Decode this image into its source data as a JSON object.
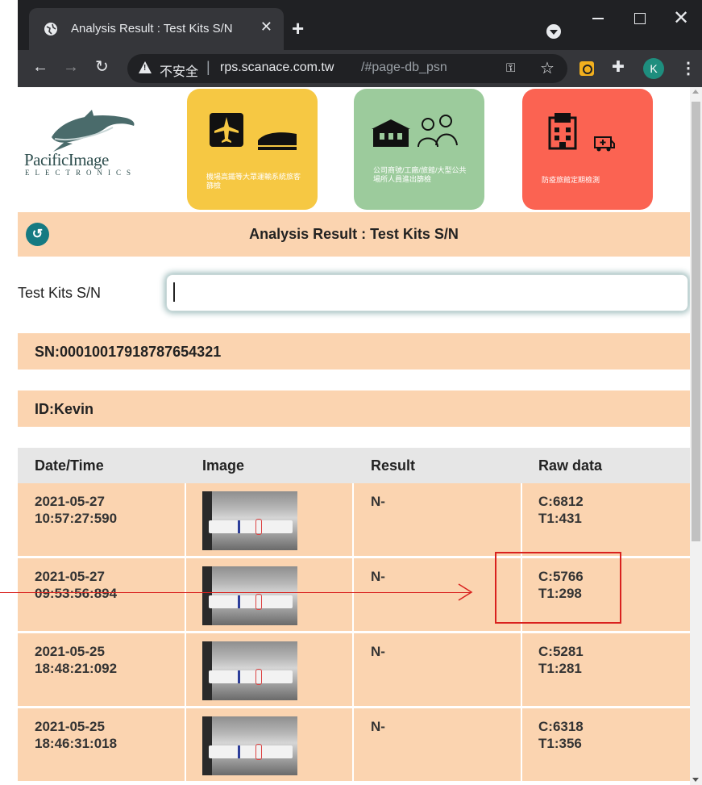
{
  "browser": {
    "tab_title": "Analysis Result : Test Kits S/N",
    "tab_close": "✕",
    "new_tab": "+",
    "insecure_label": "不安全",
    "url_host": "rps.scanace.com.tw",
    "url_path": "/#page-db_psn",
    "profile_initial": "K"
  },
  "logo": {
    "name": "PacificImage",
    "sub": "ELECTRONICS"
  },
  "cards": [
    {
      "label": "機場高鐵等大眾運輸系統旅客篩檢",
      "color": "#f6c843"
    },
    {
      "label": "公司商號/工廠/旅館/大型公共場所人員進出篩檢",
      "color": "#9ccb9c"
    },
    {
      "label": "防疫旅館定期檢測",
      "color": "#fb6352"
    }
  ],
  "header": {
    "title": "Analysis Result : Test Kits S/N",
    "back_symbol": "↺"
  },
  "search": {
    "label": "Test Kits S/N",
    "value": ""
  },
  "info": {
    "sn": "SN:00010017918787654321",
    "id": "ID:Kevin"
  },
  "table": {
    "headers": [
      "Date/Time",
      "Image",
      "Result",
      "Raw data"
    ],
    "rows": [
      {
        "date": "2021-05-27",
        "time": "10:57:27:590",
        "result": "N-",
        "c": "C:6812",
        "t1": "T1:431"
      },
      {
        "date": "2021-05-27",
        "time": "09:53:56:894",
        "result": "N-",
        "c": "C:5766",
        "t1": "T1:298"
      },
      {
        "date": "2021-05-25",
        "time": "18:48:21:092",
        "result": "N-",
        "c": "C:5281",
        "t1": "T1:281"
      },
      {
        "date": "2021-05-25",
        "time": "18:46:31:018",
        "result": "N-",
        "c": "C:6318",
        "t1": "T1:356"
      }
    ]
  },
  "colors": {
    "accent": "#fbd4b0",
    "back_button": "#157a82",
    "annotation": "#d9211e"
  }
}
